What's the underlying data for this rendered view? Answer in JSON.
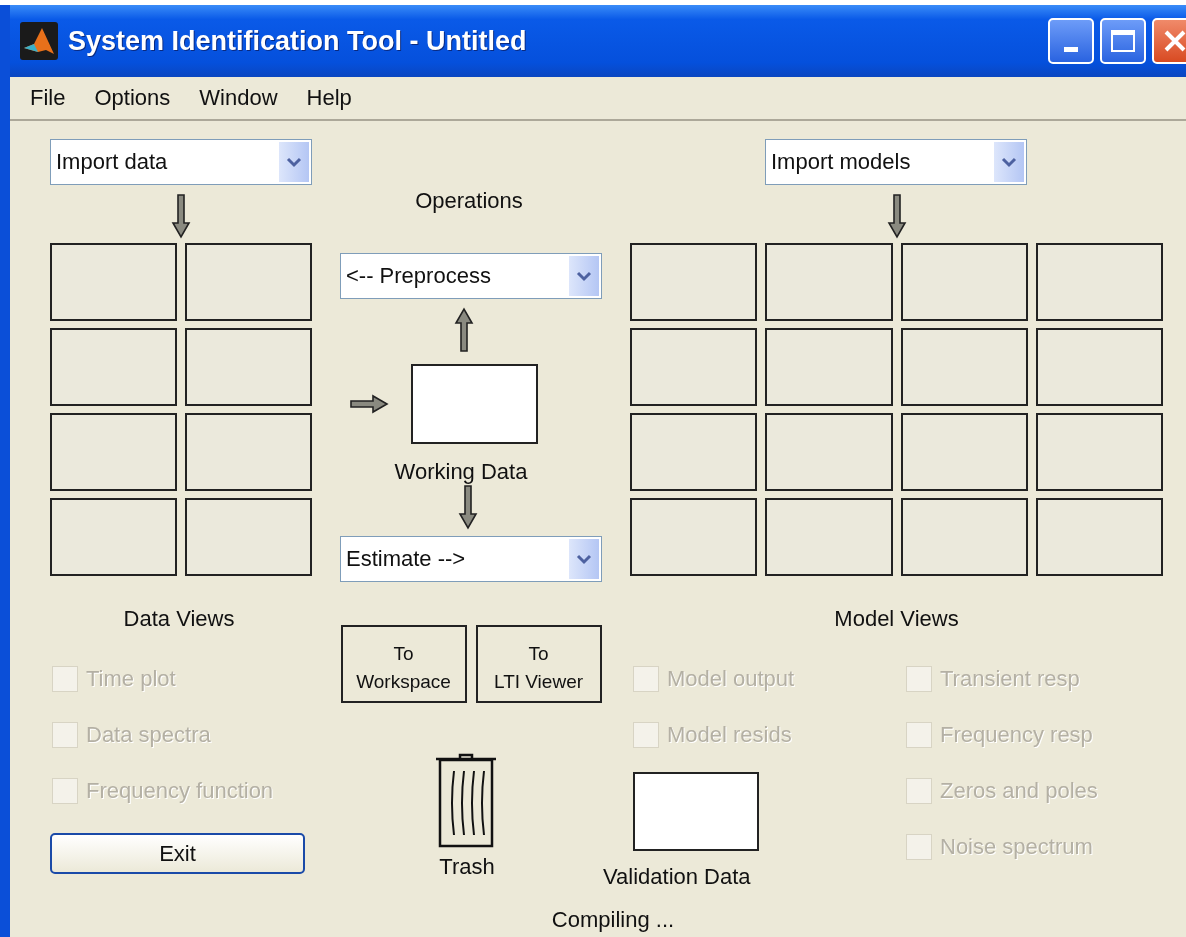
{
  "window": {
    "title": "System Identification Tool - Untitled"
  },
  "menu": [
    {
      "label": "File"
    },
    {
      "label": "Options"
    },
    {
      "label": "Window"
    },
    {
      "label": "Help"
    }
  ],
  "data_panel": {
    "import_popup": "Import data",
    "boards": [
      {
        "kind": "empty"
      },
      {
        "kind": "empty"
      },
      {
        "kind": "empty"
      },
      {
        "kind": "empty"
      },
      {
        "kind": "empty"
      },
      {
        "kind": "empty"
      },
      {
        "kind": "empty"
      },
      {
        "kind": "empty"
      }
    ],
    "views_title": "Data Views",
    "views": [
      {
        "label": "Time plot",
        "checked": false,
        "disabled": true
      },
      {
        "label": "Data spectra",
        "checked": false,
        "disabled": true
      },
      {
        "label": "Frequency function",
        "checked": false,
        "disabled": true
      }
    ],
    "exit_button": "Exit"
  },
  "operations": {
    "title": "Operations",
    "preprocess_popup": "<-- Preprocess",
    "working_data_label": "Working Data",
    "estimate_popup": "Estimate -->",
    "buttons": [
      "To\nWorkspace",
      "To\nLTI Viewer"
    ],
    "trash_label": "Trash"
  },
  "model_panel": {
    "import_popup": "Import models",
    "boards": [
      {
        "kind": "empty"
      },
      {
        "kind": "empty"
      },
      {
        "kind": "empty"
      },
      {
        "kind": "empty"
      },
      {
        "kind": "empty"
      },
      {
        "kind": "empty"
      },
      {
        "kind": "empty"
      },
      {
        "kind": "empty"
      },
      {
        "kind": "empty"
      },
      {
        "kind": "empty"
      },
      {
        "kind": "empty"
      },
      {
        "kind": "empty"
      },
      {
        "kind": "empty"
      },
      {
        "kind": "empty"
      },
      {
        "kind": "empty"
      },
      {
        "kind": "empty"
      }
    ],
    "views_title": "Model Views",
    "views_left": [
      {
        "label": "Model output",
        "checked": false,
        "disabled": true
      },
      {
        "label": "Model resids",
        "checked": false,
        "disabled": true
      }
    ],
    "views_right": [
      {
        "label": "Transient resp",
        "checked": false,
        "disabled": true
      },
      {
        "label": "Frequency resp",
        "checked": false,
        "disabled": true
      },
      {
        "label": "Zeros and poles",
        "checked": false,
        "disabled": true
      },
      {
        "label": "Noise spectrum",
        "checked": false,
        "disabled": true
      }
    ],
    "validation_label": "Validation Data"
  },
  "status": "Compiling ..."
}
